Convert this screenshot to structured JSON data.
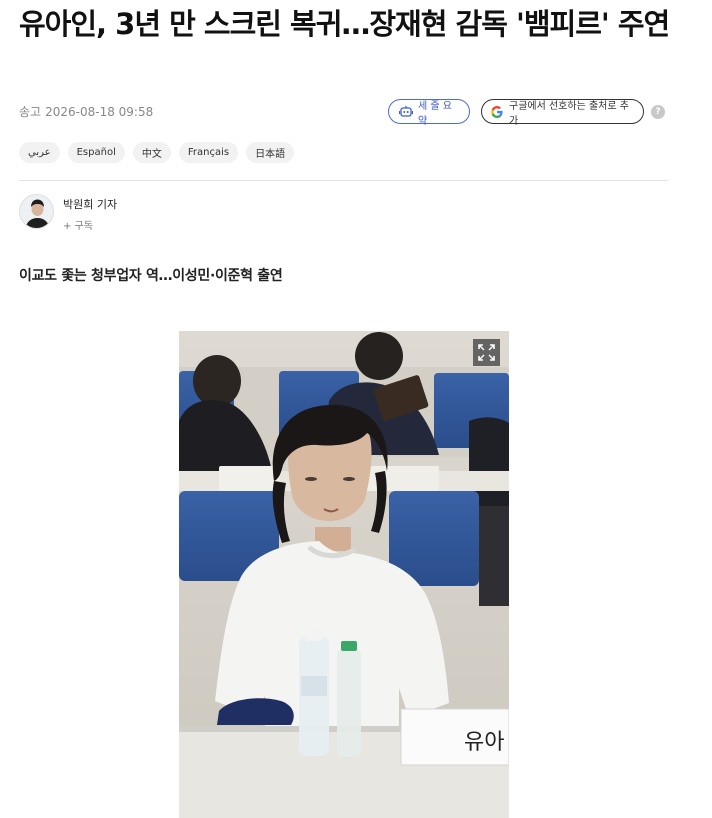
{
  "article": {
    "headline": "유아인, 3년 만 스크린 복귀…장재현 감독 '뱀피르' 주연",
    "sent_label": "송고",
    "date": "2026-08-18 09:58",
    "subtitle": "이교도 좇는 청부업자 역…이성민·이준혁 출연"
  },
  "actions": {
    "summary_label": "세 줄 요약",
    "summary_icon": "robot-icon",
    "google_label": "구글에서 선호하는 출처로 추가",
    "google_icon": "google-g-icon",
    "help_glyph": "?"
  },
  "languages": [
    "عربي",
    "Español",
    "中文",
    "Français",
    "日本語"
  ],
  "author": {
    "name": "박원희 기자",
    "subscribe": "+ 구독"
  },
  "photo": {
    "name_card_text": "유아",
    "expand_icon": "expand-icon"
  },
  "colors": {
    "accent_blue": "#3b5bc9",
    "text": "#111111",
    "muted": "#888888"
  }
}
